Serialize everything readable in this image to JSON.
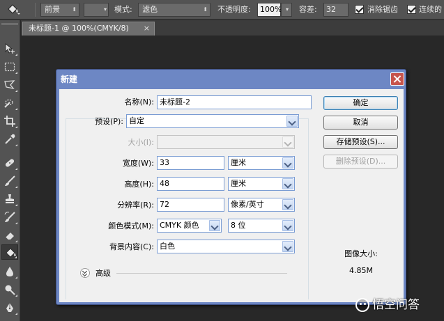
{
  "options_bar": {
    "mode_label": "模式:",
    "opacity_label": "不透明度:",
    "tolerance_label": "容差:",
    "fill_source": "前景",
    "pattern_value": "",
    "mode_value": "滤色",
    "opacity_value": "100%",
    "tolerance_value": "32",
    "antialias_label": "消除锯齿",
    "contiguous_label": "连续的"
  },
  "document_tab": {
    "title": "未标题-1 @ 100%(CMYK/8)",
    "close_glyph": "×"
  },
  "dialog": {
    "title": "新建",
    "name_label": "名称(N):",
    "name_value": "未标题-2",
    "preset_label": "预设(P):",
    "preset_value": "自定",
    "size_label": "大小(I):",
    "size_value": "",
    "width_label": "宽度(W):",
    "width_value": "33",
    "width_unit": "厘米",
    "height_label": "高度(H):",
    "height_value": "48",
    "height_unit": "厘米",
    "resolution_label": "分辨率(R):",
    "resolution_value": "72",
    "resolution_unit": "像素/英寸",
    "color_mode_label": "颜色模式(M):",
    "color_mode_value": "CMYK 颜色",
    "bit_depth_value": "8 位",
    "background_label": "背景内容(C):",
    "background_value": "白色",
    "advanced_label": "高级",
    "ok_button": "确定",
    "cancel_button": "取消",
    "save_preset_button": "存储预设(S)...",
    "delete_preset_button": "删除预设(D)...",
    "image_size_label": "图像大小:",
    "image_size_value": "4.85M"
  },
  "watermark": {
    "text": "悟空问答"
  },
  "colors": {
    "app_background": "#282828",
    "panel_gray": "#535353",
    "dialog_frame": "#6d87c4",
    "close_red": "#c7544c"
  }
}
